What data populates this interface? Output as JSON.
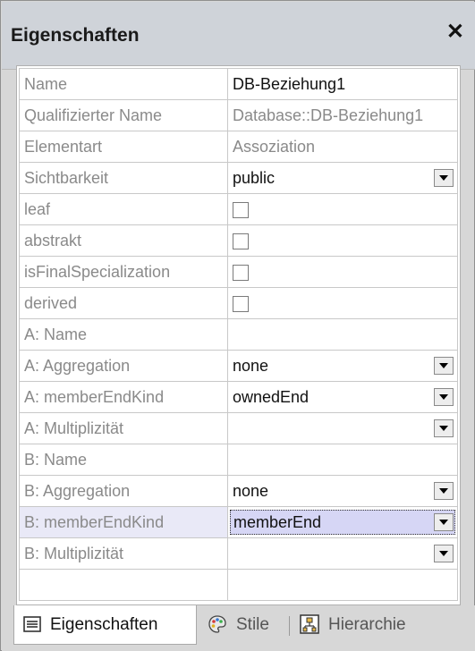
{
  "window": {
    "title": "Eigenschaften"
  },
  "rows": [
    {
      "key": "Name",
      "value": "DB-Beziehung1",
      "type": "text"
    },
    {
      "key": "Qualifizierter Name",
      "value": "Database::DB-Beziehung1",
      "type": "readonly"
    },
    {
      "key": "Elementart",
      "value": "Assoziation",
      "type": "readonly"
    },
    {
      "key": "Sichtbarkeit",
      "value": "public",
      "type": "dropdown"
    },
    {
      "key": "leaf",
      "value": "",
      "type": "checkbox",
      "checked": false
    },
    {
      "key": "abstrakt",
      "value": "",
      "type": "checkbox",
      "checked": false
    },
    {
      "key": "isFinalSpecialization",
      "value": "",
      "type": "checkbox",
      "checked": false
    },
    {
      "key": "derived",
      "value": "",
      "type": "checkbox",
      "checked": false
    },
    {
      "key": "A: Name",
      "value": "",
      "type": "text"
    },
    {
      "key": "A: Aggregation",
      "value": "none",
      "type": "dropdown"
    },
    {
      "key": "A: memberEndKind",
      "value": "ownedEnd",
      "type": "dropdown"
    },
    {
      "key": "A: Multiplizität",
      "value": "",
      "type": "dropdown"
    },
    {
      "key": "B: Name",
      "value": "",
      "type": "text"
    },
    {
      "key": "B: Aggregation",
      "value": "none",
      "type": "dropdown"
    },
    {
      "key": "B: memberEndKind",
      "value": "memberEnd",
      "type": "dropdown",
      "selected": true
    },
    {
      "key": "B: Multiplizität",
      "value": "",
      "type": "dropdown"
    }
  ],
  "tabs": [
    {
      "label": "Eigenschaften",
      "icon": "properties-icon",
      "active": true
    },
    {
      "label": "Stile",
      "icon": "palette-icon",
      "active": false
    },
    {
      "label": "Hierarchie",
      "icon": "hierarchy-icon",
      "active": false
    }
  ],
  "colors": {
    "selection": "#d6d6f5",
    "panel": "#d7d7d7",
    "title_bar": "#cfd3d9"
  }
}
